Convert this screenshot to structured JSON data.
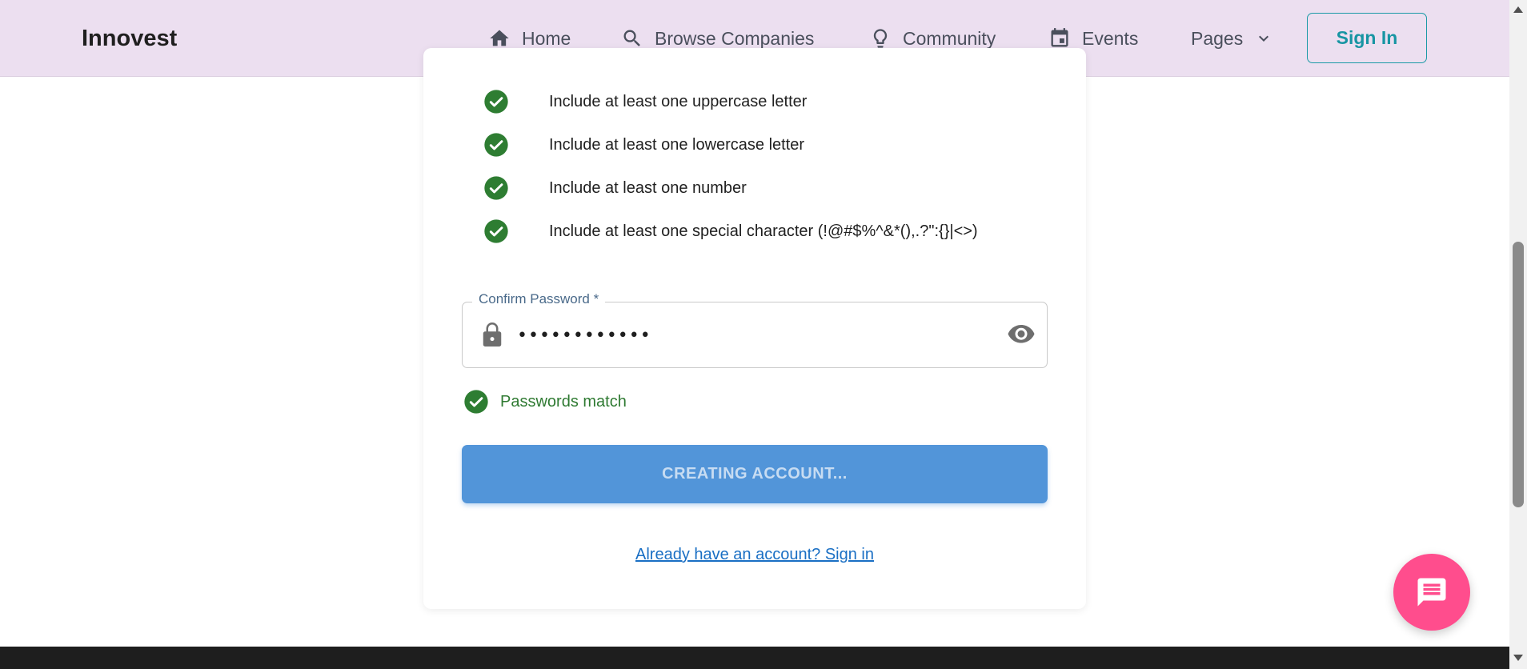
{
  "header": {
    "brand": "Innovest",
    "nav": {
      "home": "Home",
      "browse": "Browse Companies",
      "community": "Community",
      "events": "Events",
      "pages": "Pages"
    },
    "sign_in": "Sign In"
  },
  "requirements": [
    "Include at least one uppercase letter",
    "Include at least one lowercase letter",
    "Include at least one number",
    "Include at least one special character (!@#$%^&*(),.?\":{}|<>)"
  ],
  "confirm_password": {
    "label": "Confirm Password *",
    "value": "••••••••••••"
  },
  "match_text": "Passwords match",
  "submit_label": "CREATING ACCOUNT...",
  "signin_link": "Already have an account? Sign in",
  "colors": {
    "header_bg": "#ecdff0",
    "accent_teal": "#1795a3",
    "success_green": "#2f7a32",
    "button_blue": "#5295d9",
    "link_blue": "#1a6fc4",
    "chat_pink": "#ff4d8d"
  }
}
